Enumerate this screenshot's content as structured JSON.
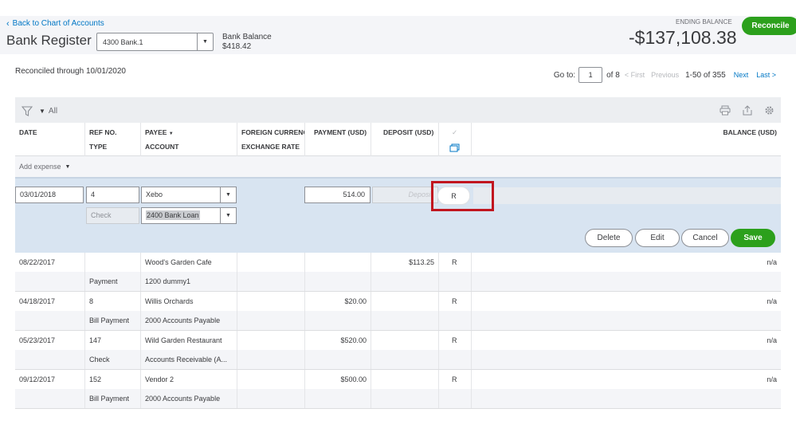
{
  "header": {
    "back_link": "Back to Chart of Accounts",
    "title": "Bank Register",
    "account": "4300 Bank.1",
    "bank_balance_label": "Bank Balance",
    "bank_balance_value": "$418.42",
    "ending_balance_label": "ENDING BALANCE",
    "ending_balance_value": "-$137,108.38",
    "reconcile_button": "Reconcile"
  },
  "reconciled_through": "Reconciled through 10/01/2020",
  "pager": {
    "goto_label": "Go to:",
    "page": "1",
    "of_pages": "of 8",
    "first": "< First",
    "previous": "Previous",
    "range": "1-50 of 355",
    "next": "Next",
    "last": "Last >"
  },
  "filter": {
    "label": "All"
  },
  "columns": {
    "date": "DATE",
    "ref_no": "REF NO.",
    "type": "TYPE",
    "payee": "PAYEE",
    "account": "ACCOUNT",
    "foreign_currency": "FOREIGN CURRENC",
    "exchange_rate": "EXCHANGE RATE",
    "payment": "PAYMENT (USD)",
    "deposit": "DEPOSIT (USD)",
    "cleared": "✓",
    "balance": "BALANCE (USD)"
  },
  "add_expense": "Add expense",
  "edit_row": {
    "date": "03/01/2018",
    "ref_no": "4",
    "payee": "Xebo",
    "payment": "514.00",
    "deposit_placeholder": "Deposit",
    "type": "Check",
    "account": "2400 Bank Loan",
    "status": "R",
    "buttons": {
      "delete": "Delete",
      "edit": "Edit",
      "cancel": "Cancel",
      "save": "Save"
    }
  },
  "rows": [
    {
      "date": "08/22/2017",
      "ref_no": "",
      "payee": "Wood's Garden Cafe",
      "payment": "",
      "deposit": "$113.25",
      "status": "R",
      "balance": "n/a",
      "type": "Payment",
      "account": "1200 dummy1"
    },
    {
      "date": "04/18/2017",
      "ref_no": "8",
      "payee": "Willis Orchards",
      "payment": "$20.00",
      "deposit": "",
      "status": "R",
      "balance": "n/a",
      "type": "Bill Payment",
      "account": "2000 Accounts Payable"
    },
    {
      "date": "05/23/2017",
      "ref_no": "147",
      "payee": "Wild Garden Restaurant",
      "payment": "$520.00",
      "deposit": "",
      "status": "R",
      "balance": "n/a",
      "type": "Check",
      "account": "Accounts Receivable (A..."
    },
    {
      "date": "09/12/2017",
      "ref_no": "152",
      "payee": "Vendor 2",
      "payment": "$500.00",
      "deposit": "",
      "status": "R",
      "balance": "n/a",
      "type": "Bill Payment",
      "account": "2000 Accounts Payable"
    }
  ],
  "colors": {
    "accent": "#2ca01c",
    "link": "#0077c5",
    "highlight_box": "#c1161f",
    "edit_bg": "#d8e4f1"
  }
}
